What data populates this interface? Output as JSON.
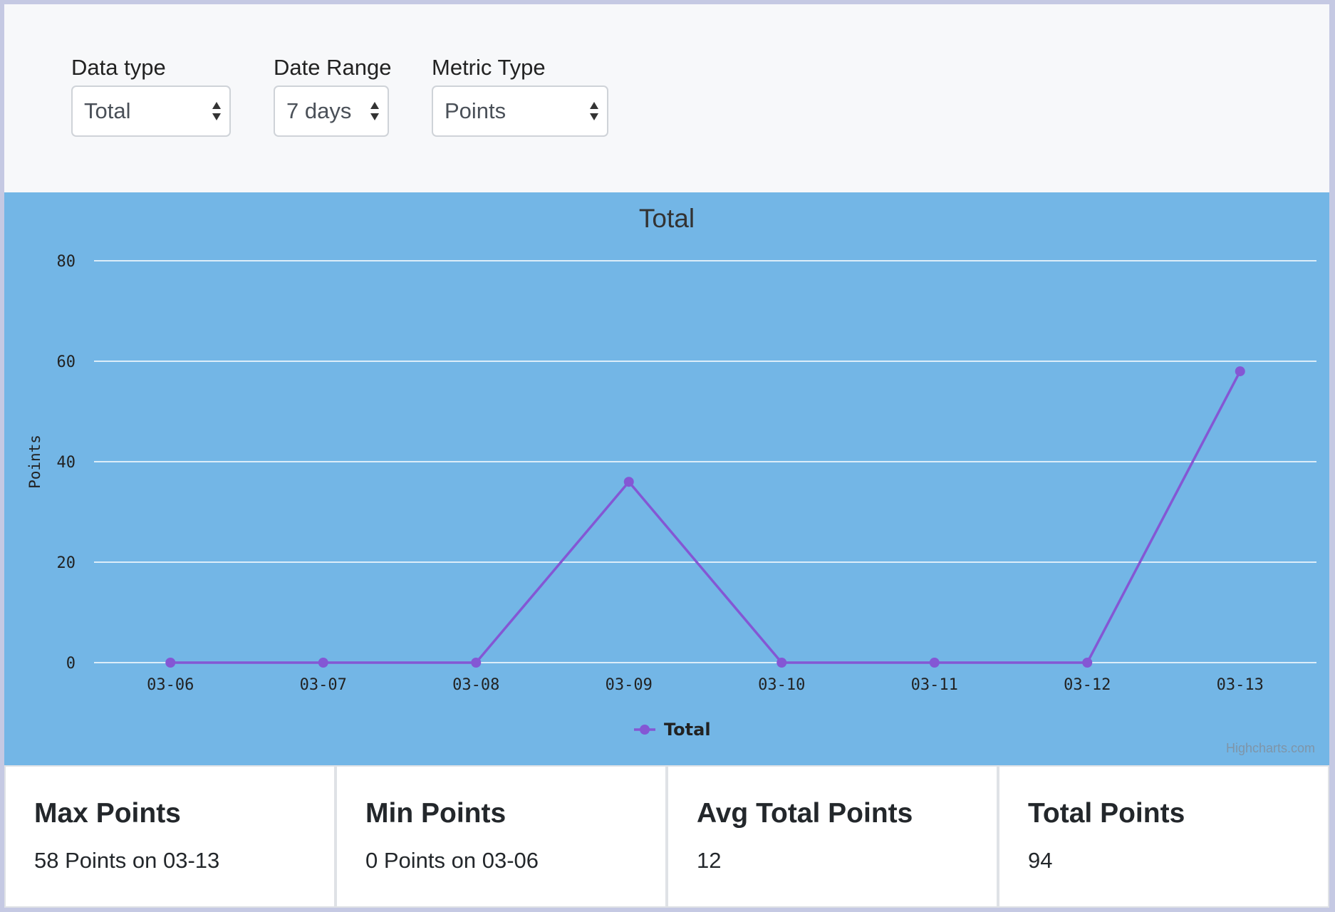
{
  "filters": {
    "data_type": {
      "label": "Data type",
      "value": "Total"
    },
    "date_range": {
      "label": "Date Range",
      "value": "7 days"
    },
    "metric_type": {
      "label": "Metric Type",
      "value": "Points"
    }
  },
  "chart_data": {
    "type": "line",
    "title": "Total",
    "xlabel": "",
    "ylabel": "Points",
    "categories": [
      "03-06",
      "03-07",
      "03-08",
      "03-09",
      "03-10",
      "03-11",
      "03-12",
      "03-13"
    ],
    "series": [
      {
        "name": "Total",
        "values": [
          0,
          0,
          0,
          36,
          0,
          0,
          0,
          58
        ]
      }
    ],
    "ylim": [
      0,
      80
    ],
    "yticks": [
      0,
      20,
      40,
      60,
      80
    ],
    "grid": true,
    "legend": "bottom-center",
    "colors": {
      "line": "#8457d4",
      "background": "#73b6e6",
      "grid": "#ffffff"
    },
    "credits": "Highcharts.com"
  },
  "stats": [
    {
      "title": "Max Points",
      "value": "58 Points on 03-13"
    },
    {
      "title": "Min Points",
      "value": "0 Points on 03-06"
    },
    {
      "title": "Avg Total Points",
      "value": "12"
    },
    {
      "title": "Total Points",
      "value": "94"
    }
  ]
}
